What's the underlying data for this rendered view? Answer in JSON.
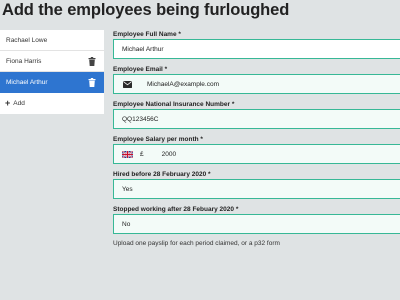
{
  "page_title": "Add the employees being furloughed",
  "sidebar": {
    "items": [
      {
        "label": "Rachael Lowe",
        "active": false,
        "deletable": false
      },
      {
        "label": "Fiona Harris",
        "active": false,
        "deletable": true
      },
      {
        "label": "Michael Arthur",
        "active": true,
        "deletable": true
      }
    ],
    "add_label": "Add"
  },
  "form": {
    "full_name": {
      "label": "Employee Full Name *",
      "value": "Michael Arthur"
    },
    "email": {
      "label": "Employee Email *",
      "value": "MichaelA@example.com",
      "icon": "envelope-icon"
    },
    "ni_number": {
      "label": "Employee National Insurance Number *",
      "value": "QQ123456C"
    },
    "salary": {
      "label": "Employee Salary per month *",
      "currency": "£",
      "value": "2000",
      "flag": "uk-flag-icon"
    },
    "hired_before": {
      "label": "Hired before 28 February 2020 *",
      "value": "Yes"
    },
    "stopped_working": {
      "label": "Stopped working after 28 Febuary 2020 *",
      "value": "No"
    },
    "upload_note": "Upload one payslip for each period claimed, or a p32 form"
  },
  "colors": {
    "background": "#dfe3e4",
    "accent_blue": "#2e75d0",
    "field_border": "#37b896"
  }
}
